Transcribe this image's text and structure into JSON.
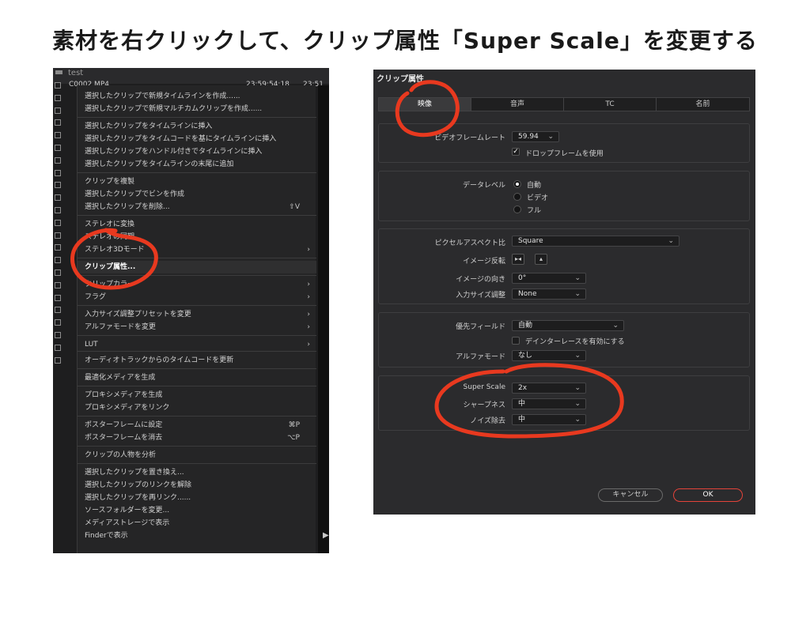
{
  "headline": "素材を右クリックして、クリップ属性「Super Scale」を変更する",
  "left": {
    "library_name": "test",
    "row_name": "C0002.MP4",
    "row_tc1": "23:59:54:18",
    "row_tc2": "23:51",
    "menu": {
      "items": [
        {
          "label": "選択したクリップで新規タイムラインを作成......",
          "shortcut": "",
          "arrow": ""
        },
        {
          "label": "選択したクリップで新規マルチカムクリップを作成......",
          "shortcut": "",
          "arrow": ""
        },
        {
          "label": "選択したクリップをタイムラインに挿入",
          "shortcut": "",
          "arrow": ""
        },
        {
          "label": "選択したクリップをタイムコードを基にタイムラインに挿入",
          "shortcut": "",
          "arrow": ""
        },
        {
          "label": "選択したクリップをハンドル付きでタイムラインに挿入",
          "shortcut": "",
          "arrow": ""
        },
        {
          "label": "選択したクリップをタイムラインの末尾に追加",
          "shortcut": "",
          "arrow": ""
        },
        {
          "label": "クリップを複製",
          "shortcut": "",
          "arrow": ""
        },
        {
          "label": "選択したクリップでビンを作成",
          "shortcut": "",
          "arrow": ""
        },
        {
          "label": "選択したクリップを削除...",
          "shortcut": "⇧V",
          "arrow": ""
        },
        {
          "label": "ステレオに変換",
          "shortcut": "",
          "arrow": ""
        },
        {
          "label": "ステレオの同期...",
          "shortcut": "",
          "arrow": ""
        },
        {
          "label": "ステレオ3Dモード",
          "shortcut": "",
          "arrow": "›"
        },
        {
          "label": "クリップ属性...",
          "shortcut": "",
          "arrow": ""
        },
        {
          "label": "クリップカラー",
          "shortcut": "",
          "arrow": "›"
        },
        {
          "label": "フラグ",
          "shortcut": "",
          "arrow": "›"
        },
        {
          "label": "入力サイズ調整プリセットを変更",
          "shortcut": "",
          "arrow": "›"
        },
        {
          "label": "アルファモードを変更",
          "shortcut": "",
          "arrow": "›"
        },
        {
          "label": "LUT",
          "shortcut": "",
          "arrow": "›"
        },
        {
          "label": "オーディオトラックからのタイムコードを更新",
          "shortcut": "",
          "arrow": ""
        },
        {
          "label": "最適化メディアを生成",
          "shortcut": "",
          "arrow": ""
        },
        {
          "label": "プロキシメディアを生成",
          "shortcut": "",
          "arrow": ""
        },
        {
          "label": "プロキシメディアをリンク",
          "shortcut": "",
          "arrow": ""
        },
        {
          "label": "ポスターフレームに設定",
          "shortcut": "⌘P",
          "arrow": ""
        },
        {
          "label": "ポスターフレームを消去",
          "shortcut": "⌥P",
          "arrow": ""
        },
        {
          "label": "クリップの人物を分析",
          "shortcut": "",
          "arrow": ""
        },
        {
          "label": "選択したクリップを置き換え...",
          "shortcut": "",
          "arrow": ""
        },
        {
          "label": "選択したクリップのリンクを解除",
          "shortcut": "",
          "arrow": ""
        },
        {
          "label": "選択したクリップを再リンク......",
          "shortcut": "",
          "arrow": ""
        },
        {
          "label": "ソースフォルダーを変更...",
          "shortcut": "",
          "arrow": ""
        },
        {
          "label": "メディアストレージで表示",
          "shortcut": "",
          "arrow": ""
        },
        {
          "label": "Finderで表示",
          "shortcut": "",
          "arrow": ""
        }
      ]
    }
  },
  "dialog": {
    "title": "クリップ属性",
    "tabs": [
      "映像",
      "音声",
      "TC",
      "名前"
    ],
    "video_framerate_label": "ビデオフレームレート",
    "video_framerate_value": "59.94",
    "dropframe_label": "ドロップフレームを使用",
    "datalevel_label": "データレベル",
    "datalevel_options": [
      "自動",
      "ビデオ",
      "フル"
    ],
    "par_label": "ピクセルアスペクト比",
    "par_value": "Square",
    "flip_label": "イメージ反転",
    "orientation_label": "イメージの向き",
    "orientation_value": "0°",
    "input_scaling_label": "入力サイズ調整",
    "input_scaling_value": "None",
    "field_label": "優先フィールド",
    "field_value": "自動",
    "deinterlace_label": "デインターレースを有効にする",
    "alpha_label": "アルファモード",
    "alpha_value": "なし",
    "superscale_label": "Super Scale",
    "superscale_value": "2x",
    "sharpness_label": "シャープネス",
    "sharpness_value": "中",
    "noise_label": "ノイズ除去",
    "noise_value": "中",
    "cancel_label": "キャンセル",
    "ok_label": "OK"
  },
  "colors": {
    "annotation_red": "#e8391f",
    "ok_border": "#e4433a"
  }
}
